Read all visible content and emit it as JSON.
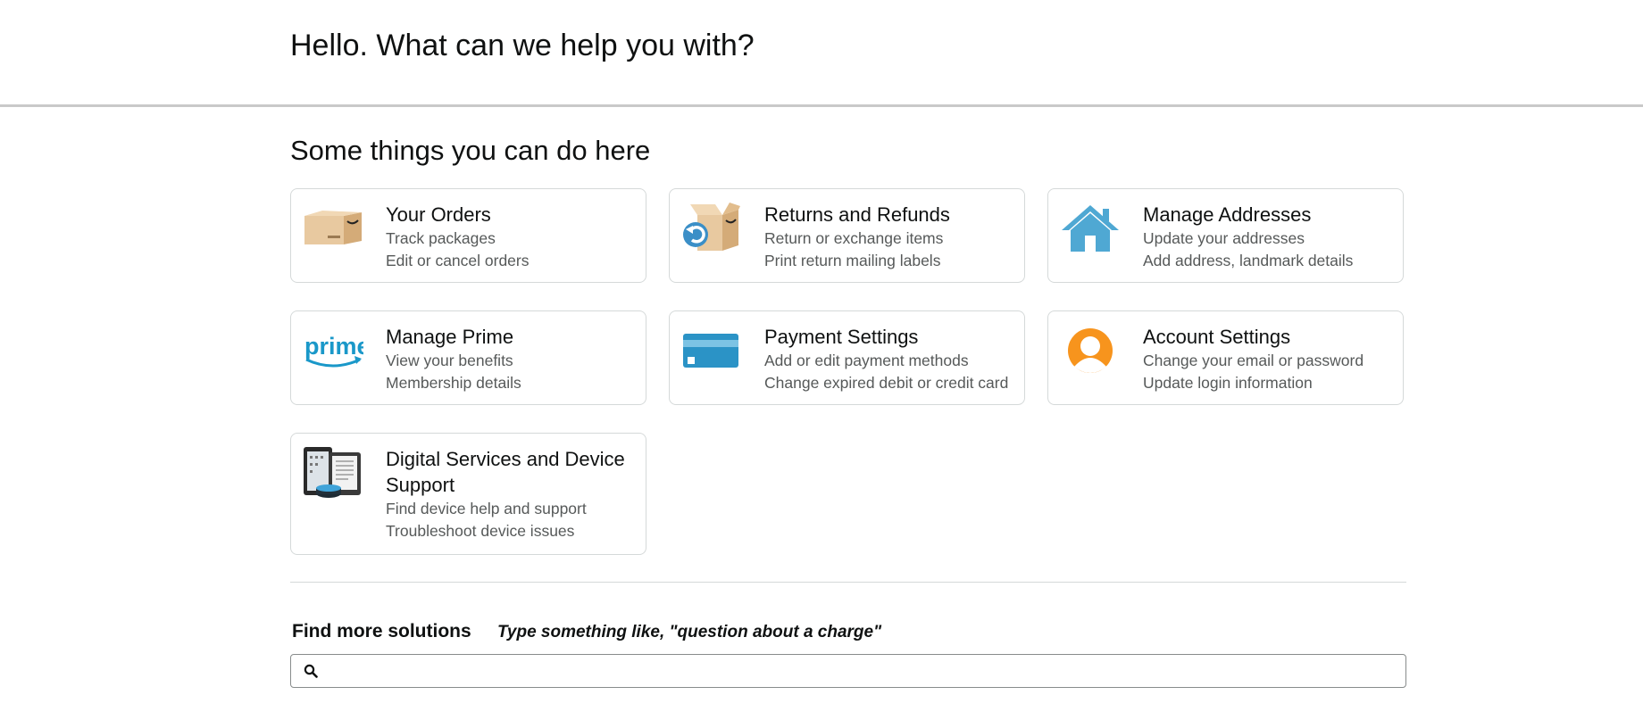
{
  "header": {
    "title": "Hello. What can we help you with?"
  },
  "section": {
    "title": "Some things you can do here"
  },
  "cards": [
    {
      "icon": "package-icon",
      "title": "Your Orders",
      "lines": [
        "Track packages",
        "Edit or cancel orders"
      ]
    },
    {
      "icon": "return-box-icon",
      "title": "Returns and Refunds",
      "lines": [
        "Return or exchange items",
        "Print return mailing labels"
      ]
    },
    {
      "icon": "house-icon",
      "title": "Manage Addresses",
      "lines": [
        "Update your addresses",
        "Add address, landmark details"
      ]
    },
    {
      "icon": "prime-logo-icon",
      "title": "Manage Prime",
      "lines": [
        "View your benefits",
        "Membership details"
      ]
    },
    {
      "icon": "credit-card-icon",
      "title": "Payment Settings",
      "lines": [
        "Add or edit payment methods",
        "Change expired debit or credit card"
      ]
    },
    {
      "icon": "user-avatar-icon",
      "title": "Account Settings",
      "lines": [
        "Change your email or password",
        "Update login information"
      ]
    },
    {
      "icon": "devices-icon",
      "title": "Digital Services and Device Support",
      "lines": [
        "Find device help and support",
        "Troubleshoot device issues"
      ]
    }
  ],
  "find": {
    "label": "Find more solutions",
    "hint": "Type something like, \"question about a charge\"",
    "search_value": "",
    "search_icon": "search-icon"
  },
  "prime_logo_text": "prime",
  "colors": {
    "accent_blue": "#1a98c9",
    "avatar_orange": "#f7941d",
    "house_blue": "#4fa8d3"
  }
}
